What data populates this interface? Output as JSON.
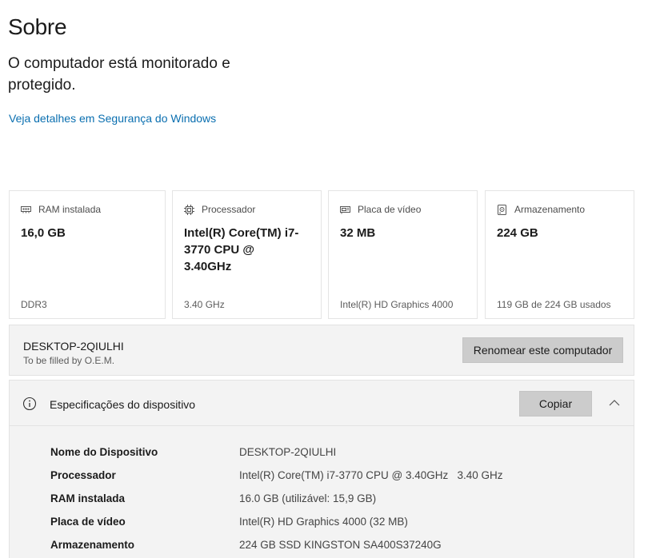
{
  "page": {
    "title": "Sobre",
    "protection_text": "O computador está monitorado e protegido.",
    "security_link": "Veja detalhes em Segurança do Windows"
  },
  "cards": [
    {
      "icon": "ram-icon",
      "label": "RAM instalada",
      "value": "16,0 GB",
      "footer": "DDR3"
    },
    {
      "icon": "processor-icon",
      "label": "Processador",
      "value": "Intel(R) Core(TM) i7-3770 CPU @ 3.40GHz",
      "footer": "3.40 GHz"
    },
    {
      "icon": "graphics-card-icon",
      "label": "Placa de vídeo",
      "value": "32 MB",
      "footer": "Intel(R) HD Graphics 4000"
    },
    {
      "icon": "storage-icon",
      "label": "Armazenamento",
      "value": "224 GB",
      "footer": "119 GB de 224 GB usados"
    }
  ],
  "device": {
    "name": "DESKTOP-2QIULHI",
    "subtitle": "To be filled by O.E.M.",
    "rename_label": "Renomear este computador"
  },
  "specs": {
    "title": "Especificações do dispositivo",
    "copy_label": "Copiar",
    "rows": [
      {
        "label": "Nome do Dispositivo",
        "value": "DESKTOP-2QIULHI"
      },
      {
        "label": "Processador",
        "value": "Intel(R) Core(TM) i7-3770 CPU @ 3.40GHz   3.40 GHz"
      },
      {
        "label": "RAM instalada",
        "value": "16.0 GB (utilizável: 15,9 GB)"
      },
      {
        "label": "Placa de vídeo",
        "value": "Intel(R) HD Graphics 4000 (32 MB)"
      },
      {
        "label": "Armazenamento",
        "value": "224 GB SSD KINGSTON SA400S37240G"
      }
    ]
  }
}
